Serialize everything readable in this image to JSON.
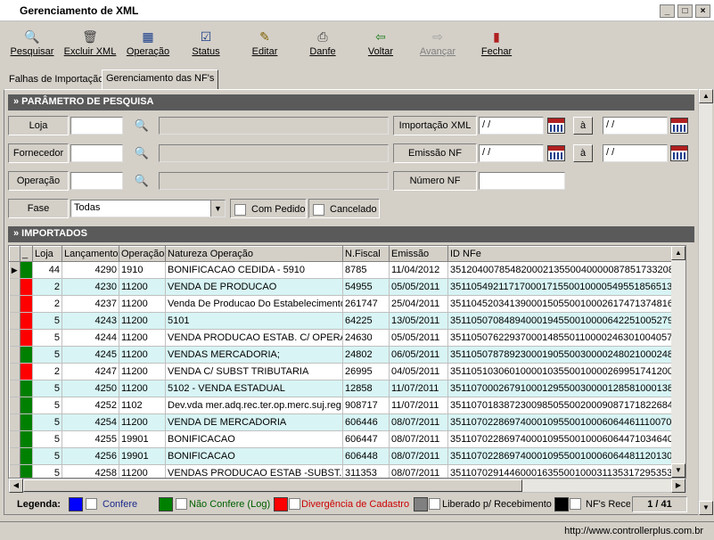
{
  "window": {
    "title": "Gerenciamento de XML"
  },
  "toolbar": [
    {
      "label": "Pesquisar",
      "icon": "search-icon",
      "enabled": true
    },
    {
      "label": "Excluir XML",
      "icon": "trash-icon",
      "enabled": true
    },
    {
      "label": "Operação",
      "icon": "calculator-icon",
      "enabled": true
    },
    {
      "label": "Status",
      "icon": "check-doc-icon",
      "enabled": true
    },
    {
      "label": "Editar",
      "icon": "edit-doc-icon",
      "enabled": true
    },
    {
      "label": "Danfe",
      "icon": "printer-icon",
      "enabled": true
    },
    {
      "label": "Voltar",
      "icon": "back-arrow-icon",
      "enabled": true
    },
    {
      "label": "Avançar",
      "icon": "forward-arrow-icon",
      "enabled": false
    },
    {
      "label": "Fechar",
      "icon": "exit-door-icon",
      "enabled": true
    }
  ],
  "tabs": [
    {
      "label": "Falhas de Importação",
      "active": false
    },
    {
      "label": "Gerenciamento das NF's",
      "active": true
    }
  ],
  "params": {
    "header": "» PARÂMETRO DE PESQUISA",
    "loja_label": "Loja",
    "fornecedor_label": "Fornecedor",
    "operacao_label": "Operação",
    "fase_label": "Fase",
    "fase_value": "Todas",
    "com_pedido_label": "Com Pedido",
    "cancelado_label": "Cancelado",
    "importacao_label": "Importação XML",
    "emissao_label": "Emissão NF",
    "numero_label": "Número NF",
    "date_placeholder": " / /",
    "a_label": "à"
  },
  "imported": {
    "header": "» IMPORTADOS",
    "columns": [
      "_",
      "Loja",
      "Lançamento",
      "Operação",
      "Natureza Operação",
      "N.Fiscal",
      "Emissão",
      "ID NFe"
    ],
    "rows": [
      {
        "status": "green",
        "loja": "44",
        "lanc": "4290",
        "op": "1910",
        "nat": "BONIFICACAO CEDIDA - 5910",
        "nf": "8785",
        "emi": "11/04/2012",
        "id": "35120400785482000213550040000087851733208441"
      },
      {
        "status": "red",
        "loja": "2",
        "lanc": "4230",
        "op": "11200",
        "nat": "VENDA DE PRODUCAO",
        "nf": "54955",
        "emi": "05/05/2011",
        "id": "35110549211717000171550010000549551856513667"
      },
      {
        "status": "red",
        "loja": "2",
        "lanc": "4237",
        "op": "11200",
        "nat": "Venda De Producao Do Estabelecimento",
        "nf": "261747",
        "emi": "25/04/2011",
        "id": "35110452034139000150550010002617471374816222"
      },
      {
        "status": "red",
        "loja": "5",
        "lanc": "4243",
        "op": "11200",
        "nat": "5101",
        "nf": "64225",
        "emi": "13/05/2011",
        "id": "35110507084894000194550010000642251005279950"
      },
      {
        "status": "red",
        "loja": "5",
        "lanc": "4244",
        "op": "11200",
        "nat": "VENDA PRODUCAO ESTAB. C/ OPERA",
        "nf": "24630",
        "emi": "05/05/2011",
        "id": "35110507622937000148550110000246301004057338"
      },
      {
        "status": "green",
        "loja": "5",
        "lanc": "4245",
        "op": "11200",
        "nat": "VENDAS MERCADORIA;",
        "nf": "24802",
        "emi": "06/05/2011",
        "id": "35110507878923000190550030000248021000248024"
      },
      {
        "status": "red",
        "loja": "2",
        "lanc": "4247",
        "op": "11200",
        "nat": "VENDA C/ SUBST TRIBUTARIA",
        "nf": "26995",
        "emi": "04/05/2011",
        "id": "35110510306010000103550010000269951741200509"
      },
      {
        "status": "green",
        "loja": "5",
        "lanc": "4250",
        "op": "11200",
        "nat": "5102 - VENDA ESTADUAL",
        "nf": "12858",
        "emi": "11/07/2011",
        "id": "35110700026791000129550030000128581000138526"
      },
      {
        "status": "green",
        "loja": "5",
        "lanc": "4252",
        "op": "1102",
        "nat": "Dev.vda mer.adq.rec.ter.op.merc.suj.reg.s",
        "nf": "908717",
        "emi": "11/07/2011",
        "id": "35110701838723009850550020009087171822684275"
      },
      {
        "status": "green",
        "loja": "5",
        "lanc": "4254",
        "op": "11200",
        "nat": "VENDA DE MERCADORIA",
        "nf": "606446",
        "emi": "08/07/2011",
        "id": "35110702286974000109550010006064461110070050"
      },
      {
        "status": "green",
        "loja": "5",
        "lanc": "4255",
        "op": "19901",
        "nat": "BONIFICACAO",
        "nf": "606447",
        "emi": "08/07/2011",
        "id": "35110702286974000109550010006064471034640308"
      },
      {
        "status": "green",
        "loja": "5",
        "lanc": "4256",
        "op": "19901",
        "nat": "BONIFICACAO",
        "nf": "606448",
        "emi": "08/07/2011",
        "id": "35110702286974000109550010006064481120130352"
      },
      {
        "status": "green",
        "loja": "5",
        "lanc": "4258",
        "op": "11200",
        "nat": "VENDAS PRODUCAO ESTAB -SUBST.T",
        "nf": "311353",
        "emi": "08/07/2011",
        "id": "35110702914460001635500100031135317295353650"
      }
    ]
  },
  "legend": {
    "title": "Legenda:",
    "items": [
      {
        "label": "Confere",
        "color": "#0000ff",
        "text_color": "#1a2a8a"
      },
      {
        "label": "Não Confere (Log)",
        "color": "#008000",
        "text_color": "#006000"
      },
      {
        "label": "Divergência de Cadastro",
        "color": "#ff0000",
        "text_color": "#cc0000"
      },
      {
        "label": "Liberado p/ Recebimento",
        "color": "#808080",
        "text_color": "#000000"
      },
      {
        "label": "NF's Recebidas",
        "color": "#000000",
        "text_color": "#000000"
      }
    ],
    "page": "1 / 41"
  },
  "status_bar": {
    "url": "http://www.controllerplus.com.br"
  },
  "colors": {
    "green": "#008000",
    "red": "#ff0000"
  }
}
